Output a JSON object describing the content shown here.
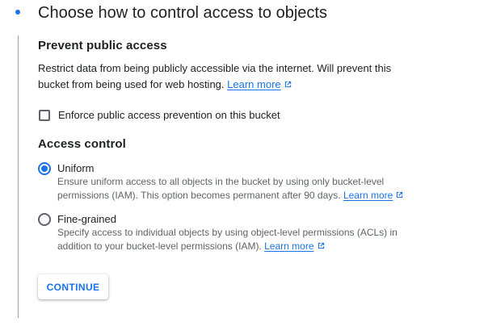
{
  "step": {
    "title": "Choose how to control access to objects"
  },
  "prevent_public_access": {
    "heading": "Prevent public access",
    "description": "Restrict data from being publicly accessible via the internet. Will prevent this bucket from being used for web hosting.",
    "learn_more": "Learn more",
    "checkbox_label": "Enforce public access prevention on this bucket",
    "checkbox_checked": false
  },
  "access_control": {
    "heading": "Access control",
    "options": [
      {
        "label": "Uniform",
        "description": "Ensure uniform access to all objects in the bucket by using only bucket-level permissions (IAM). This option becomes permanent after 90 days.",
        "learn_more": "Learn more",
        "selected": true
      },
      {
        "label": "Fine-grained",
        "description": "Specify access to individual objects by using object-level permissions (ACLs) in addition to your bucket-level permissions (IAM).",
        "learn_more": "Learn more",
        "selected": false
      }
    ]
  },
  "actions": {
    "continue_label": "CONTINUE"
  },
  "colors": {
    "accent": "#1a73e8",
    "text": "#202124",
    "secondary_text": "#5f6368"
  },
  "icons": {
    "step_marker": "step-dot-icon",
    "external_link": "external-link-icon"
  }
}
